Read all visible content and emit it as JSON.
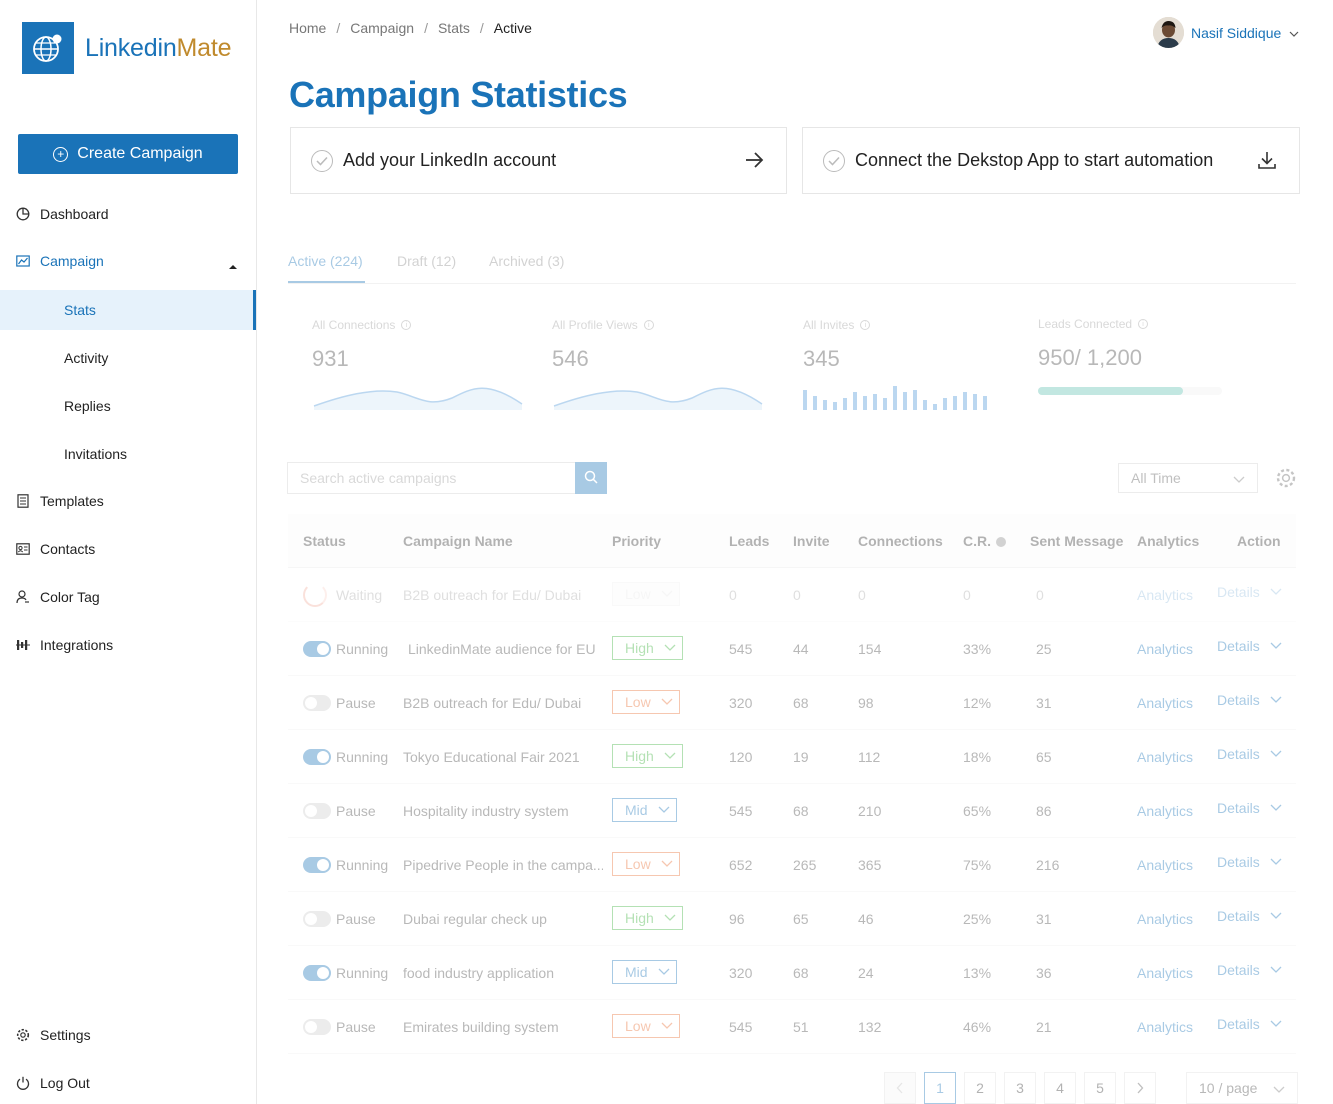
{
  "brand": {
    "name_part1": "Linkedin",
    "name_part2": "Mate"
  },
  "sidebar": {
    "create_label": "Create Campaign",
    "items": [
      {
        "label": "Dashboard",
        "icon": "pie-chart-icon"
      },
      {
        "label": "Campaign",
        "icon": "line-chart-icon"
      },
      {
        "label": "Stats"
      },
      {
        "label": "Activity"
      },
      {
        "label": "Replies"
      },
      {
        "label": "Invitations"
      },
      {
        "label": "Templates",
        "icon": "document-icon"
      },
      {
        "label": "Contacts",
        "icon": "contact-card-icon"
      },
      {
        "label": "Color Tag",
        "icon": "user-tag-icon"
      },
      {
        "label": "Integrations",
        "icon": "integrations-icon"
      }
    ],
    "settings_label": "Settings",
    "logout_label": "Log Out"
  },
  "breadcrumb": {
    "home": "Home",
    "campaign": "Campaign",
    "stats": "Stats",
    "current": "Active",
    "separator": "/"
  },
  "user": {
    "name": "Nasif Siddique"
  },
  "page_title": "Campaign Statistics",
  "setup": {
    "linkedin": "Add your LinkedIn account",
    "desktop": "Connect the Dekstop App to start automation"
  },
  "tabs": {
    "active": "Active (224)",
    "draft": "Draft (12)",
    "archived": "Archived (3)"
  },
  "stats": {
    "connections": {
      "label": "All Connections",
      "value": "931"
    },
    "profile_views": {
      "label": "All Profile Views",
      "value": "546"
    },
    "invites": {
      "label": "All Invites",
      "value": "345"
    },
    "leads": {
      "label": "Leads Connected",
      "value": "950/ 1,200",
      "progress": 0.79
    }
  },
  "search": {
    "placeholder": "Search active campaigns"
  },
  "time_filter": {
    "selected": "All Time"
  },
  "table": {
    "headers": {
      "status": "Status",
      "name": "Campaign Name",
      "priority": "Priority",
      "leads": "Leads",
      "invite": "Invite",
      "connections": "Connections",
      "cr": "C.R.",
      "sent": "Sent Message",
      "analytics": "Analytics",
      "action": "Action"
    },
    "rows": [
      {
        "status": "Waiting",
        "name": "B2B outreach for Edu/ Dubai",
        "priority": "Low",
        "leads": "0",
        "invite": "0",
        "connections": "0",
        "cr": "0",
        "sent": "0",
        "analytics": "Analytics",
        "details": "Details"
      },
      {
        "status": "Running",
        "name": "LinkedinMate audience for EU",
        "priority": "High",
        "leads": "545",
        "invite": "44",
        "connections": "154",
        "cr": "33%",
        "sent": "25",
        "analytics": "Analytics",
        "details": "Details"
      },
      {
        "status": "Pause",
        "name": "B2B outreach for Edu/ Dubai",
        "priority": "Low",
        "leads": "320",
        "invite": "68",
        "connections": "98",
        "cr": "12%",
        "sent": "31",
        "analytics": "Analytics",
        "details": "Details"
      },
      {
        "status": "Running",
        "name": "Tokyo Educational Fair 2021",
        "priority": "High",
        "leads": "120",
        "invite": "19",
        "connections": "112",
        "cr": "18%",
        "sent": "65",
        "analytics": "Analytics",
        "details": "Details"
      },
      {
        "status": "Pause",
        "name": "Hospitality  industry system",
        "priority": "Mid",
        "leads": "545",
        "invite": "68",
        "connections": "210",
        "cr": "65%",
        "sent": "86",
        "analytics": "Analytics",
        "details": "Details"
      },
      {
        "status": "Running",
        "name": "Pipedrive People in the campa...",
        "priority": "Low",
        "leads": "652",
        "invite": "265",
        "connections": "365",
        "cr": "75%",
        "sent": "216",
        "analytics": "Analytics",
        "details": "Details"
      },
      {
        "status": "Pause",
        "name": "Dubai regular check up",
        "priority": "High",
        "leads": "96",
        "invite": "65",
        "connections": "46",
        "cr": "25%",
        "sent": "31",
        "analytics": "Analytics",
        "details": "Details"
      },
      {
        "status": "Running",
        "name": "food industry application",
        "priority": "Mid",
        "leads": "320",
        "invite": "68",
        "connections": "24",
        "cr": "13%",
        "sent": "36",
        "analytics": "Analytics",
        "details": "Details"
      },
      {
        "status": "Pause",
        "name": "Emirates building system",
        "priority": "Low",
        "leads": "545",
        "invite": "51",
        "connections": "132",
        "cr": "46%",
        "sent": "21",
        "analytics": "Analytics",
        "details": "Details"
      }
    ]
  },
  "pagination": {
    "pages": [
      "1",
      "2",
      "3",
      "4",
      "5"
    ],
    "current": "1",
    "per_page": "10 / page"
  },
  "colors": {
    "primary": "#1a73b8",
    "brand_accent": "#c08a2d",
    "high": "#3ab03a",
    "low": "#e86a2e",
    "mid": "#1a73b8"
  }
}
